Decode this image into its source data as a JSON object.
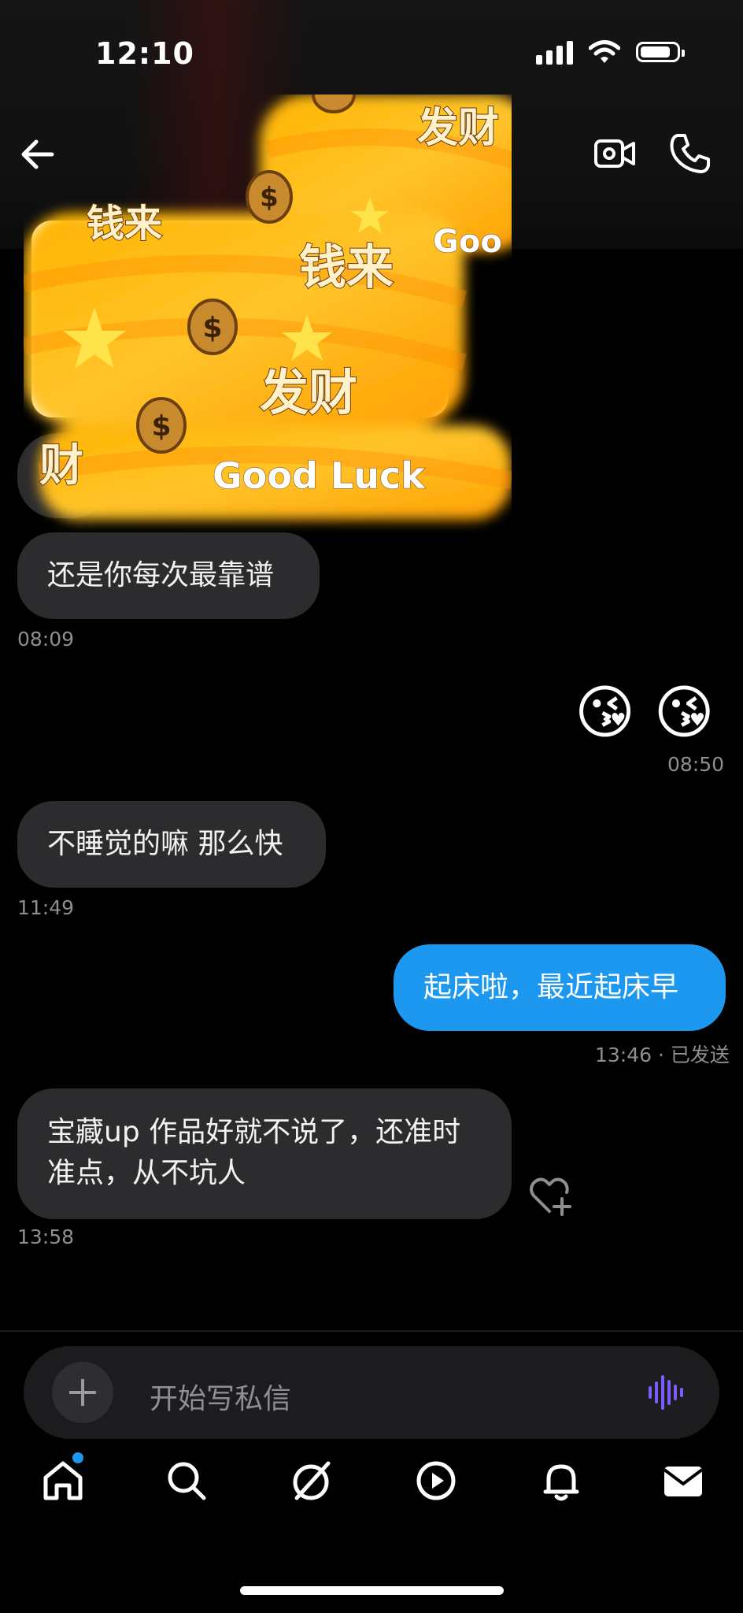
{
  "status_bar": {
    "time": "12:10"
  },
  "header": {
    "back_icon": "back-arrow-icon",
    "actions": [
      "video-call-icon",
      "phone-call-icon"
    ]
  },
  "sticker": {
    "words": [
      "发财",
      "钱来",
      "钱来",
      "发财",
      "财",
      "Good Luck",
      "Goo"
    ]
  },
  "messages": [
    {
      "side": "in",
      "text": "还是你每次最靠谱",
      "time": "08:09"
    },
    {
      "side": "out",
      "emoji": "😘 😘",
      "time": "08:50"
    },
    {
      "side": "in",
      "text": "不睡觉的嘛 那么快",
      "time": "11:49"
    },
    {
      "side": "out",
      "text": "起床啦，最近起床早",
      "time": "13:46 · 已发送"
    },
    {
      "side": "in",
      "text": "宝藏up 作品好就不说了，还准时准点，从不坑人",
      "time": "13:58"
    }
  ],
  "composer": {
    "placeholder": "开始写私信"
  },
  "tabs": [
    "home-icon",
    "search-icon",
    "explore-icon",
    "play-icon",
    "bell-icon",
    "mail-icon"
  ],
  "colors": {
    "outgoing": "#1c98f0",
    "incoming": "#2c2c2e",
    "voice": "#7b5cff"
  }
}
